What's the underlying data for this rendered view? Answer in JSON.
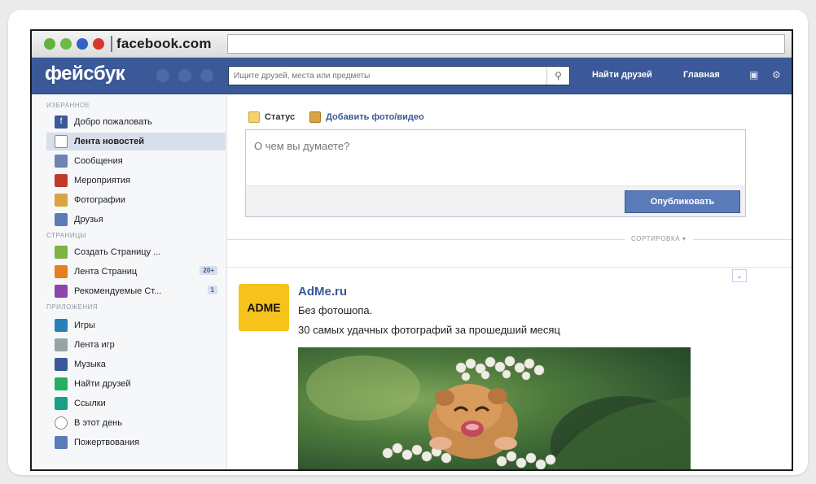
{
  "browser": {
    "url": "facebook.com"
  },
  "header": {
    "logo": "фейсбук",
    "search_placeholder": "Ищите друзей, места или предметы",
    "search_icon": "magnifier-icon",
    "find_friends": "Найти друзей",
    "home": "Главная",
    "bg_color": "#3b5998"
  },
  "sidebar": {
    "section_favorites": "ИЗБРАННОЕ",
    "section_pages": "СТРАНИЦЫ",
    "section_apps": "ПРИЛОЖЕНИЯ",
    "favorites": [
      {
        "label": "Добро пожаловать",
        "icon": "facebook-icon"
      },
      {
        "label": "Лента новостей",
        "icon": "news-feed-icon"
      },
      {
        "label": "Сообщения",
        "icon": "messages-icon"
      },
      {
        "label": "Мероприятия",
        "icon": "calendar-icon"
      },
      {
        "label": "Фотографии",
        "icon": "photos-icon"
      },
      {
        "label": "Друзья",
        "icon": "friends-icon"
      }
    ],
    "pages": [
      {
        "label": "Создать Страницу ...",
        "icon": "create-page-icon"
      },
      {
        "label": "Лента Страниц",
        "icon": "pages-feed-icon",
        "badge": "20+"
      },
      {
        "label": "Рекомендуемые Ст...",
        "icon": "recommended-icon",
        "badge": "1"
      }
    ],
    "apps": [
      {
        "label": "Игры",
        "icon": "games-icon"
      },
      {
        "label": "Лента игр",
        "icon": "games-feed-icon"
      },
      {
        "label": "Музыка",
        "icon": "music-icon"
      },
      {
        "label": "Найти друзей",
        "icon": "find-friends-icon"
      },
      {
        "label": "Ссылки",
        "icon": "links-icon"
      },
      {
        "label": "В этот день",
        "icon": "on-this-day-icon"
      },
      {
        "label": "Пожертвования",
        "icon": "donations-icon"
      }
    ]
  },
  "composer": {
    "tab_status": "Статус",
    "tab_photo": "Добавить фото/видео",
    "placeholder": "О чем вы думаете?",
    "publish": "Опубликовать"
  },
  "feed": {
    "sort": "СОРТИРОВКА ▾",
    "post": {
      "avatar_text": "ADME",
      "author": "AdMe.ru",
      "line1": "Без фотошопа.",
      "line2": "30 самых удачных фотографий за прошедший месяц"
    }
  }
}
